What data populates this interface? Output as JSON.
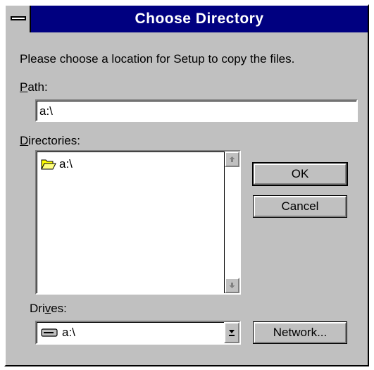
{
  "window": {
    "title": "Choose Directory",
    "instruction": "Please choose a location for Setup to copy the files."
  },
  "path": {
    "label_mnemonic": "P",
    "label_rest": "ath:",
    "value": "a:\\"
  },
  "directories": {
    "label_mnemonic": "D",
    "label_rest": "irectories:",
    "items": [
      {
        "label": "a:\\",
        "icon": "open-folder-icon"
      }
    ]
  },
  "drives": {
    "label_pre": "Dri",
    "label_mnemonic": "v",
    "label_rest": "es:",
    "selected": "a:\\",
    "icon": "floppy-drive-icon"
  },
  "buttons": {
    "ok": "OK",
    "cancel": "Cancel",
    "network": "Network..."
  },
  "colors": {
    "titlebar": "#000080",
    "face": "#c0c0c0"
  }
}
